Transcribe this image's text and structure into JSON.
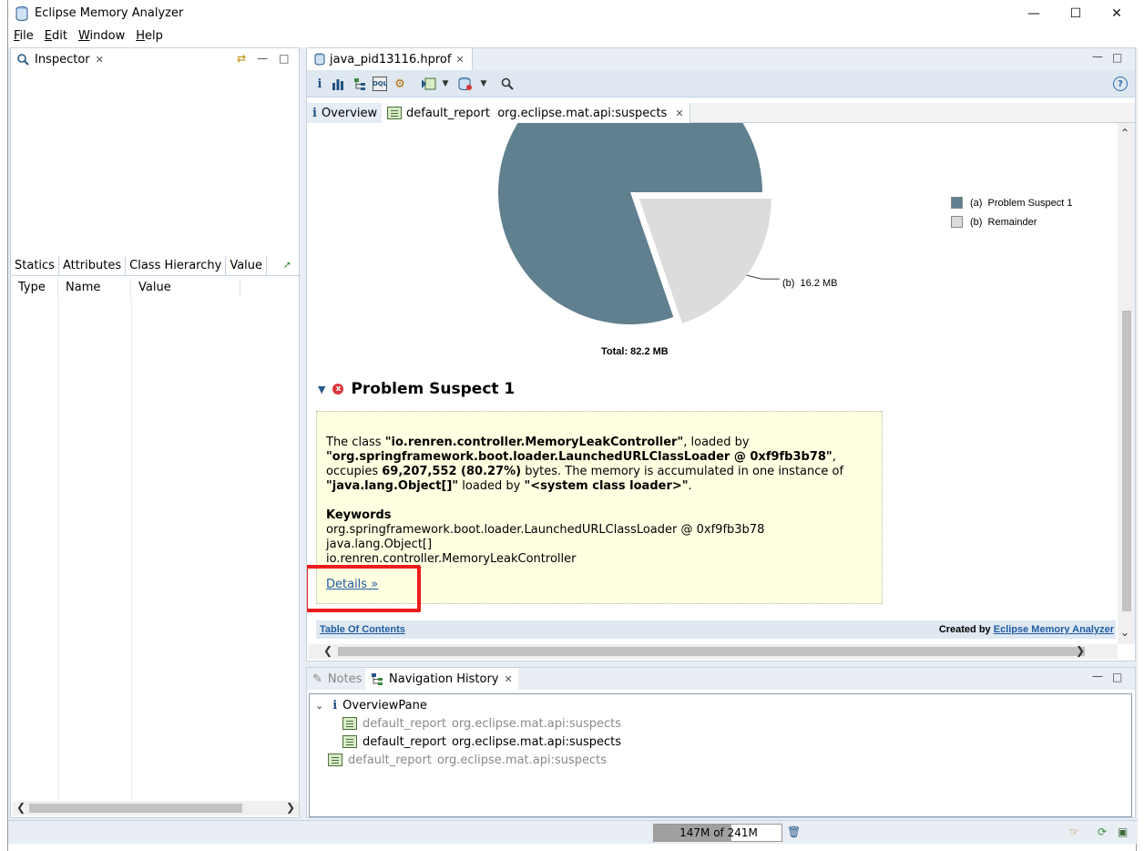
{
  "window": {
    "title": "Eclipse Memory Analyzer"
  },
  "menu": [
    {
      "u": "F",
      "rest": "ile"
    },
    {
      "u": "E",
      "rest": "dit"
    },
    {
      "u": "W",
      "rest": "indow"
    },
    {
      "u": "H",
      "rest": "elp"
    }
  ],
  "inspector": {
    "tab_label": "Inspector",
    "subtabs": [
      "Statics",
      "Attributes",
      "Class Hierarchy",
      "Value"
    ],
    "columns": [
      "Type",
      "Name",
      "Value"
    ]
  },
  "editor": {
    "file_tab": "java_pid13116.hprof",
    "subtabs": [
      {
        "label": "Overview"
      },
      {
        "label": "default_report  org.eclipse.mat.api:suspects"
      }
    ],
    "chart_data": {
      "type": "pie",
      "slices": [
        {
          "name": "(a)  Problem Suspect 1",
          "value_mb": 66.0,
          "color": "#607f8f"
        },
        {
          "name": "(b)  Remainder",
          "value_mb": 16.2,
          "color": "#dcdcdc"
        }
      ],
      "slice_label": "(b)  16.2 MB",
      "total_label": "Total: 82.2 MB",
      "legend_position": "top-right"
    },
    "suspect": {
      "heading": "Problem Suspect 1",
      "p1_a": "The class ",
      "p1_b": "\"io.renren.controller.MemoryLeakController\"",
      "p1_c": ", loaded by",
      "p1_d": "\"org.springframework.boot.loader.LaunchedURLClassLoader @ 0xf9fb3b78\"",
      "p1_e": ",",
      "p1_f": "occupies ",
      "p1_g": "69,207,552 (80.27%)",
      "p1_h": " bytes. The memory is accumulated in one instance of",
      "p1_i": "\"java.lang.Object[]\"",
      "p1_j": " loaded by ",
      "p1_k": "\"<system class loader>\"",
      "p1_l": ".",
      "keywords_title": "Keywords",
      "keywords": [
        "org.springframework.boot.loader.LaunchedURLClassLoader @ 0xf9fb3b78",
        "java.lang.Object[]",
        "io.renren.controller.MemoryLeakController"
      ],
      "details_link": "Details »"
    },
    "footer": {
      "toc": "Table Of Contents",
      "created_by": "Created by ",
      "created_link": "Eclipse Memory Analyzer"
    }
  },
  "bottom": {
    "notes_tab": "Notes",
    "history_tab": "Navigation History",
    "tree": [
      {
        "label": "OverviewPane",
        "cmd": ""
      },
      {
        "label": "default_report",
        "cmd": "org.eclipse.mat.api:suspects"
      },
      {
        "label": "default_report",
        "cmd": "org.eclipse.mat.api:suspects"
      },
      {
        "label": "default_report",
        "cmd": "org.eclipse.mat.api:suspects"
      }
    ]
  },
  "status": {
    "heap_text": "147M of 241M",
    "heap_used_fraction": 0.61
  },
  "colors": {
    "accent": "#1f5ca3",
    "highlight": "#ee1c1c",
    "suspect_bg": "#ffffe1"
  }
}
